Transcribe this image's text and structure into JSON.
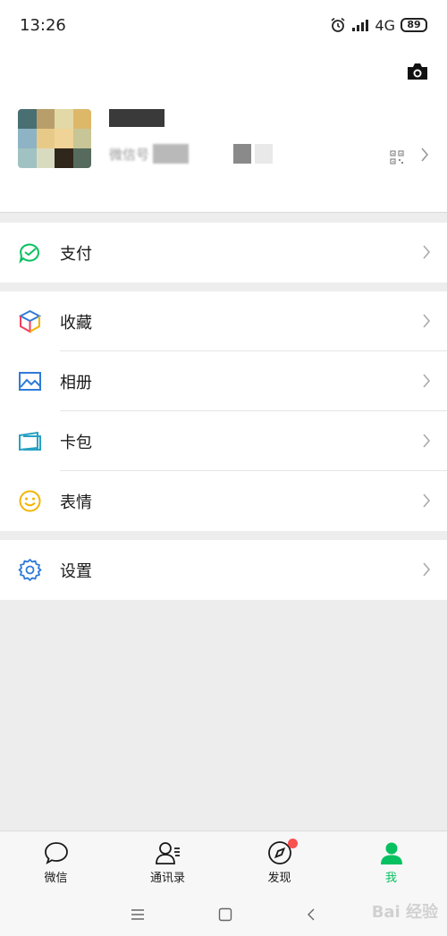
{
  "status_bar": {
    "time": "13:26",
    "network": "4G",
    "battery": "89"
  },
  "profile": {
    "wxid_label": "微信号"
  },
  "menu": {
    "pay": {
      "label": "支付",
      "icon": "wallet-check-icon",
      "color": "#07c160"
    },
    "favorites": {
      "label": "收藏",
      "icon": "cube-icon"
    },
    "album": {
      "label": "相册",
      "icon": "picture-icon",
      "color": "#2f7bd8"
    },
    "cards": {
      "label": "卡包",
      "icon": "card-wallet-icon",
      "color": "#26a1c4"
    },
    "stickers": {
      "label": "表情",
      "icon": "smiley-icon",
      "color": "#f4b400"
    },
    "settings": {
      "label": "设置",
      "icon": "gear-icon",
      "color": "#2f7bd8"
    }
  },
  "tabs": [
    {
      "label": "微信",
      "icon": "chat-bubble-icon",
      "active": false
    },
    {
      "label": "通讯录",
      "icon": "contacts-icon",
      "active": false
    },
    {
      "label": "发现",
      "icon": "compass-icon",
      "active": false,
      "badge": true
    },
    {
      "label": "我",
      "icon": "person-icon",
      "active": true
    }
  ],
  "colors": {
    "accent": "#07c160",
    "badge": "#fa5151",
    "background": "#ededed"
  },
  "watermark": "Bai 经验"
}
